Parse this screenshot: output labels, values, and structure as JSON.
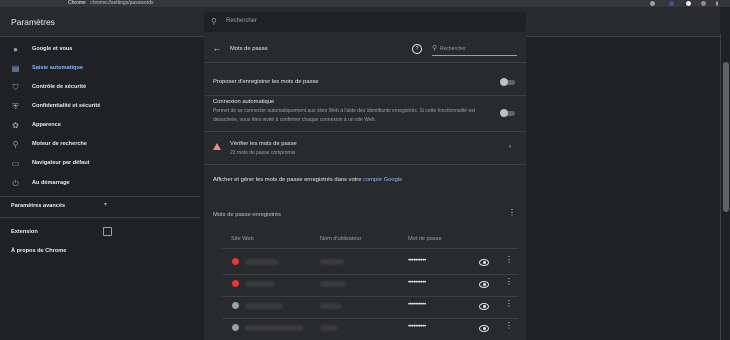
{
  "browser": {
    "url_prefix": "Chrome",
    "url_path": "chrome://settings/passwords"
  },
  "app_title": "Paramètres",
  "top_search_placeholder": "Rechercher",
  "sidebar": {
    "items": [
      {
        "label": "Google et vous",
        "icon": "person-icon"
      },
      {
        "label": "Saisie automatique",
        "icon": "autofill-icon",
        "active": true
      },
      {
        "label": "Contrôle de sécurité",
        "icon": "shield-check-icon"
      },
      {
        "label": "Confidentialité et sécurité",
        "icon": "shield-icon"
      },
      {
        "label": "Apparence",
        "icon": "palette-icon"
      },
      {
        "label": "Moteur de recherche",
        "icon": "search-icon"
      },
      {
        "label": "Navigateur par défaut",
        "icon": "browser-icon"
      },
      {
        "label": "Au démarrage",
        "icon": "power-icon"
      }
    ],
    "advanced_label": "Paramètres avancés",
    "extensions_label": "Extension",
    "about_label": "À propos de Chrome"
  },
  "passwords": {
    "back_label": "Mots de passe",
    "search_placeholder": "Rechercher",
    "offer_save_label": "Proposer d'enregistrer les mots de passe",
    "autologin_title": "Connexion automatique",
    "autologin_desc": "Permet de se connecter automatiquement aux sites Web à l'aide des identifiants enregistrés. Si cette fonctionnalité est désactivée, vous êtes invité à confirmer chaque connexion à un site Web.",
    "check_title": "Vérifier les mots de passe",
    "check_sub": "22 mots de passe compromis",
    "manage_text": "Afficher et gérer les mots de passe enregistrés dans votre ",
    "manage_link": "compte Google",
    "saved_title": "Mots de passe enregistrés",
    "columns": [
      "Site Web",
      "Nom d'utilisateur",
      "Mot de passe"
    ],
    "rows": [
      {
        "favicon": "#e53935",
        "password": "••••••••••"
      },
      {
        "favicon": "#e53935",
        "password": "••••••••••"
      },
      {
        "favicon": "#9aa0a6",
        "password": "••••••••••"
      },
      {
        "favicon": "#9aa0a6",
        "password": "••••••••••"
      }
    ]
  }
}
